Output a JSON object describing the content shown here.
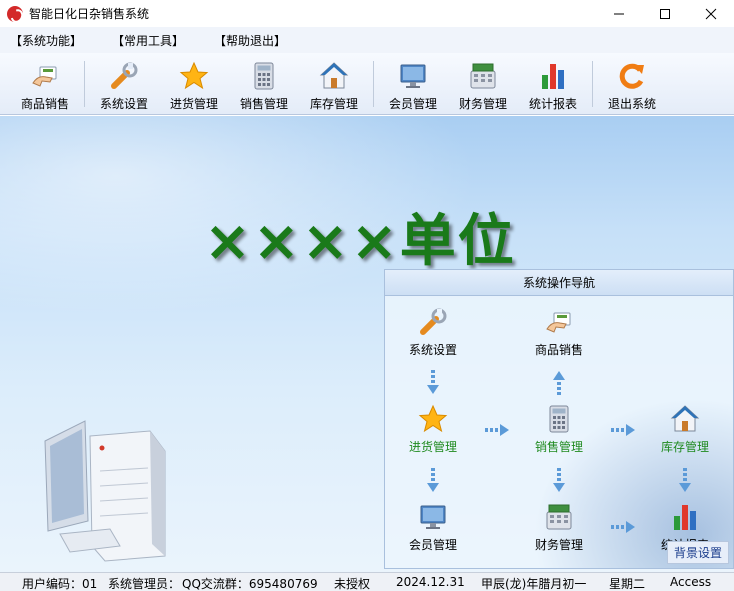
{
  "window": {
    "title": "智能日化日杂销售系统"
  },
  "menu": [
    "【系统功能】",
    "【常用工具】",
    "【帮助退出】"
  ],
  "toolbar": [
    {
      "label": "商品销售",
      "icon": "hand-card-icon"
    },
    {
      "label": "系统设置",
      "icon": "wrench-icon"
    },
    {
      "label": "进货管理",
      "icon": "star-icon"
    },
    {
      "label": "销售管理",
      "icon": "calculator-icon"
    },
    {
      "label": "库存管理",
      "icon": "house-icon"
    },
    {
      "label": "会员管理",
      "icon": "monitor-icon"
    },
    {
      "label": "财务管理",
      "icon": "cash-register-icon"
    },
    {
      "label": "统计报表",
      "icon": "bar-chart-icon"
    },
    {
      "label": "退出系统",
      "icon": "exit-icon"
    }
  ],
  "main": {
    "unit_title": "××××单位"
  },
  "nav": {
    "title": "系统操作导航",
    "nodes": {
      "settings": "系统设置",
      "sales": "商品销售",
      "purchase": "进货管理",
      "sales_mgmt": "销售管理",
      "inventory": "库存管理",
      "member": "会员管理",
      "finance": "财务管理",
      "report": "统计报表"
    },
    "bg_button": "背景设置"
  },
  "status": {
    "user_code": "用户编码：01",
    "admin": "系统管理员：",
    "group": "QQ交流群：695480769",
    "license": "未授权",
    "date": "2024.12.31",
    "lunar": "甲辰(龙)年腊月初一",
    "weekday": "星期二",
    "db": "Access"
  },
  "colors": {
    "accent_green": "#1a7a1a",
    "nav_green": "#1f8a1f"
  }
}
